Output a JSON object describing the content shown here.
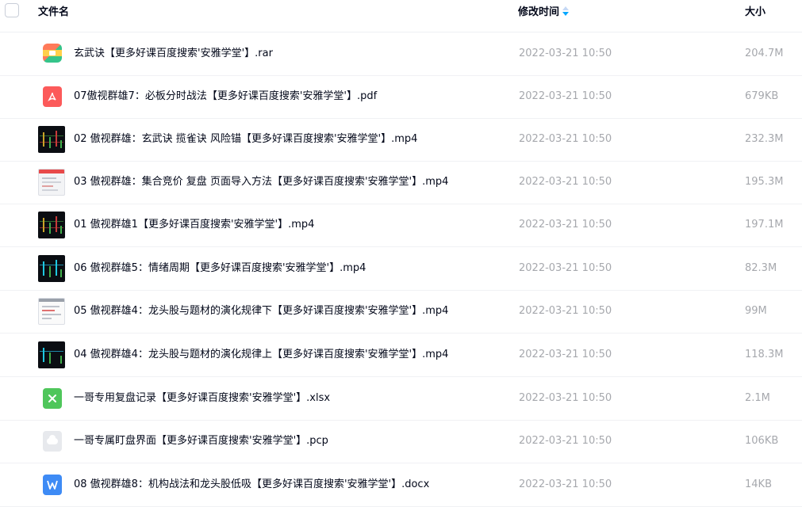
{
  "header": {
    "name_label": "文件名",
    "time_label": "修改时间",
    "size_label": "大小",
    "sort_icon": "sort-descending-icon"
  },
  "colors": {
    "accent": "#06a7ff",
    "meta_text": "#a6a8ad",
    "primary_text": "#03081a"
  },
  "files": [
    {
      "name": "玄武诀【更多好课百度搜索'安雅学堂'】.rar",
      "time": "2022-03-21 10:50",
      "size": "204.7M",
      "type": "rar",
      "icon": "archive-icon"
    },
    {
      "name": "07傲视群雄7：必板分时战法【更多好课百度搜索'安雅学堂'】.pdf",
      "time": "2022-03-21 10:50",
      "size": "679KB",
      "type": "pdf",
      "icon": "pdf-icon"
    },
    {
      "name": "02 傲视群雄：玄武诀 揽雀诀 风险锚【更多好课百度搜索'安雅学堂'】.mp4",
      "time": "2022-03-21 10:50",
      "size": "232.3M",
      "type": "mp4",
      "icon": "video-thumbnail-dark"
    },
    {
      "name": "03 傲视群雄：集合竞价 复盘 页面导入方法【更多好课百度搜索'安雅学堂'】.mp4",
      "time": "2022-03-21 10:50",
      "size": "195.3M",
      "type": "mp4",
      "icon": "video-thumbnail-light"
    },
    {
      "name": "01 傲视群雄1【更多好课百度搜索'安雅学堂'】.mp4",
      "time": "2022-03-21 10:50",
      "size": "197.1M",
      "type": "mp4",
      "icon": "video-thumbnail-dark"
    },
    {
      "name": "06 傲视群雄5：情绪周期【更多好课百度搜索'安雅学堂'】.mp4",
      "time": "2022-03-21 10:50",
      "size": "82.3M",
      "type": "mp4",
      "icon": "video-thumbnail-dark"
    },
    {
      "name": "05 傲视群雄4：龙头股与题材的演化规律下【更多好课百度搜索'安雅学堂'】.mp4",
      "time": "2022-03-21 10:50",
      "size": "99M",
      "type": "mp4",
      "icon": "video-thumbnail-light2"
    },
    {
      "name": "04 傲视群雄4：龙头股与题材的演化规律上【更多好课百度搜索'安雅学堂'】.mp4",
      "time": "2022-03-21 10:50",
      "size": "118.3M",
      "type": "mp4",
      "icon": "video-thumbnail-dark"
    },
    {
      "name": "一哥专用复盘记录【更多好课百度搜索'安雅学堂'】.xlsx",
      "time": "2022-03-21 10:50",
      "size": "2.1M",
      "type": "xlsx",
      "icon": "excel-icon"
    },
    {
      "name": "一哥专属盯盘界面【更多好课百度搜索'安雅学堂'】.pcp",
      "time": "2022-03-21 10:50",
      "size": "106KB",
      "type": "pcp",
      "icon": "cloud-file-icon"
    },
    {
      "name": "08 傲视群雄8：机构战法和龙头股低吸【更多好课百度搜索'安雅学堂'】.docx",
      "time": "2022-03-21 10:50",
      "size": "14KB",
      "type": "docx",
      "icon": "word-icon"
    }
  ]
}
